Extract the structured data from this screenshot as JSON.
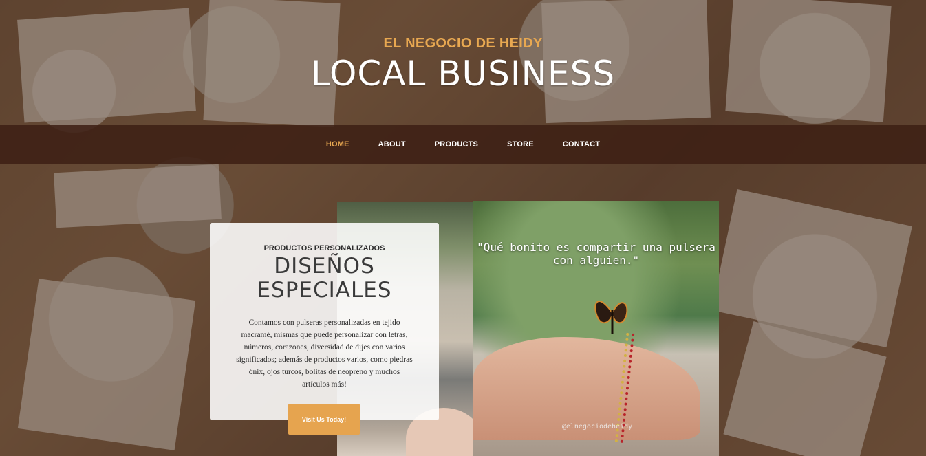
{
  "header": {
    "brand_small": "EL NEGOCIO DE HEIDY",
    "brand_large": "LOCAL BUSINESS"
  },
  "nav": {
    "items": [
      {
        "label": "HOME",
        "active": true
      },
      {
        "label": "ABOUT",
        "active": false
      },
      {
        "label": "PRODUCTS",
        "active": false
      },
      {
        "label": "STORE",
        "active": false
      },
      {
        "label": "CONTACT",
        "active": false
      }
    ]
  },
  "feature": {
    "kicker": "PRODUCTOS PERSONALIZADOS",
    "title": "DISEÑOS ESPECIALES",
    "text": "Contamos con pulseras personalizadas en tejido macramé, mismas que puede personalizar con letras, números, corazones, diversidad de dijes con varios significados; además de productos varios, como piedras ónix, ojos turcos, bolitas de neopreno y muchos artículos más!",
    "button_label": "Visit Us Today!"
  },
  "photo": {
    "quote": "\"Qué bonito es compartir una pulsera con alguien.\"",
    "watermark": "@elnegociodeheidy"
  },
  "colors": {
    "accent": "#e8a851",
    "button": "#e6a44f",
    "nav_bg": "#3e2014"
  }
}
